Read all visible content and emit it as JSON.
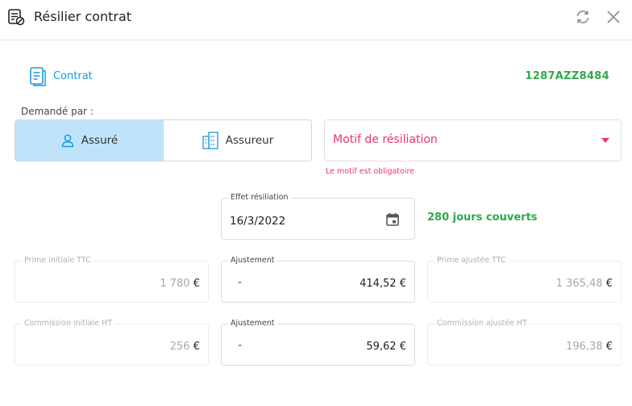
{
  "header": {
    "title": "Résilier contrat",
    "title_icon": "doc-cancel-icon",
    "refresh_icon": "refresh-icon",
    "close_icon": "close-icon"
  },
  "contract": {
    "label": "Contrat",
    "number": "1287AZZ8484"
  },
  "requested_by": {
    "label": "Demandé par :",
    "options": [
      {
        "label": "Assuré",
        "icon": "user-icon",
        "active": true
      },
      {
        "label": "Assureur",
        "icon": "building-icon",
        "active": false
      }
    ]
  },
  "motif": {
    "placeholder": "Motif de résiliation",
    "error": "Le motif est obligatoire"
  },
  "effet": {
    "label": "Effet résiliation",
    "value": "16/3/2022",
    "covered": "280 jours couverts"
  },
  "prime": {
    "initial_label": "Prime initiale TTC",
    "initial_value": "1 780",
    "adjust_label": "Ajustement",
    "adjust_sign": "-",
    "adjust_value": "414,52",
    "adjusted_label": "Prime ajustée TTC",
    "adjusted_value": "1 365,48"
  },
  "commission": {
    "initial_label": "Commission initiale HT",
    "initial_value": "256",
    "adjust_label": "Ajustement",
    "adjust_sign": "-",
    "adjust_value": "59,62",
    "adjusted_label": "Commission ajustée HT",
    "adjusted_value": "196,38"
  },
  "currency": "€",
  "colors": {
    "accent_blue": "#1a9bd7",
    "success_green": "#2eaa4a",
    "error_pink": "#e8337a",
    "toggle_active": "#bfe4fa"
  }
}
